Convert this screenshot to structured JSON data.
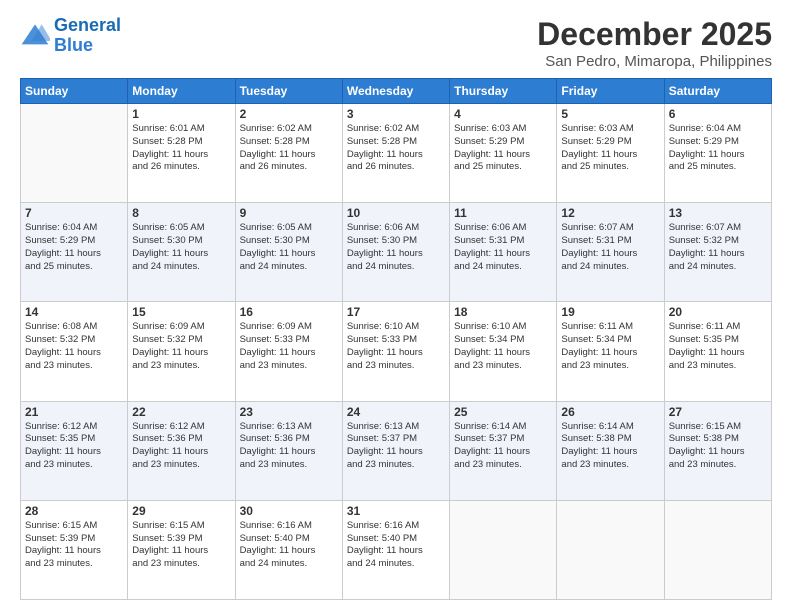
{
  "logo": {
    "line1": "General",
    "line2": "Blue"
  },
  "title": "December 2025",
  "subtitle": "San Pedro, Mimaropa, Philippines",
  "days_header": [
    "Sunday",
    "Monday",
    "Tuesday",
    "Wednesday",
    "Thursday",
    "Friday",
    "Saturday"
  ],
  "weeks": [
    [
      {
        "day": "",
        "info": ""
      },
      {
        "day": "1",
        "info": "Sunrise: 6:01 AM\nSunset: 5:28 PM\nDaylight: 11 hours\nand 26 minutes."
      },
      {
        "day": "2",
        "info": "Sunrise: 6:02 AM\nSunset: 5:28 PM\nDaylight: 11 hours\nand 26 minutes."
      },
      {
        "day": "3",
        "info": "Sunrise: 6:02 AM\nSunset: 5:28 PM\nDaylight: 11 hours\nand 26 minutes."
      },
      {
        "day": "4",
        "info": "Sunrise: 6:03 AM\nSunset: 5:29 PM\nDaylight: 11 hours\nand 25 minutes."
      },
      {
        "day": "5",
        "info": "Sunrise: 6:03 AM\nSunset: 5:29 PM\nDaylight: 11 hours\nand 25 minutes."
      },
      {
        "day": "6",
        "info": "Sunrise: 6:04 AM\nSunset: 5:29 PM\nDaylight: 11 hours\nand 25 minutes."
      }
    ],
    [
      {
        "day": "7",
        "info": "Sunrise: 6:04 AM\nSunset: 5:29 PM\nDaylight: 11 hours\nand 25 minutes."
      },
      {
        "day": "8",
        "info": "Sunrise: 6:05 AM\nSunset: 5:30 PM\nDaylight: 11 hours\nand 24 minutes."
      },
      {
        "day": "9",
        "info": "Sunrise: 6:05 AM\nSunset: 5:30 PM\nDaylight: 11 hours\nand 24 minutes."
      },
      {
        "day": "10",
        "info": "Sunrise: 6:06 AM\nSunset: 5:30 PM\nDaylight: 11 hours\nand 24 minutes."
      },
      {
        "day": "11",
        "info": "Sunrise: 6:06 AM\nSunset: 5:31 PM\nDaylight: 11 hours\nand 24 minutes."
      },
      {
        "day": "12",
        "info": "Sunrise: 6:07 AM\nSunset: 5:31 PM\nDaylight: 11 hours\nand 24 minutes."
      },
      {
        "day": "13",
        "info": "Sunrise: 6:07 AM\nSunset: 5:32 PM\nDaylight: 11 hours\nand 24 minutes."
      }
    ],
    [
      {
        "day": "14",
        "info": "Sunrise: 6:08 AM\nSunset: 5:32 PM\nDaylight: 11 hours\nand 23 minutes."
      },
      {
        "day": "15",
        "info": "Sunrise: 6:09 AM\nSunset: 5:32 PM\nDaylight: 11 hours\nand 23 minutes."
      },
      {
        "day": "16",
        "info": "Sunrise: 6:09 AM\nSunset: 5:33 PM\nDaylight: 11 hours\nand 23 minutes."
      },
      {
        "day": "17",
        "info": "Sunrise: 6:10 AM\nSunset: 5:33 PM\nDaylight: 11 hours\nand 23 minutes."
      },
      {
        "day": "18",
        "info": "Sunrise: 6:10 AM\nSunset: 5:34 PM\nDaylight: 11 hours\nand 23 minutes."
      },
      {
        "day": "19",
        "info": "Sunrise: 6:11 AM\nSunset: 5:34 PM\nDaylight: 11 hours\nand 23 minutes."
      },
      {
        "day": "20",
        "info": "Sunrise: 6:11 AM\nSunset: 5:35 PM\nDaylight: 11 hours\nand 23 minutes."
      }
    ],
    [
      {
        "day": "21",
        "info": "Sunrise: 6:12 AM\nSunset: 5:35 PM\nDaylight: 11 hours\nand 23 minutes."
      },
      {
        "day": "22",
        "info": "Sunrise: 6:12 AM\nSunset: 5:36 PM\nDaylight: 11 hours\nand 23 minutes."
      },
      {
        "day": "23",
        "info": "Sunrise: 6:13 AM\nSunset: 5:36 PM\nDaylight: 11 hours\nand 23 minutes."
      },
      {
        "day": "24",
        "info": "Sunrise: 6:13 AM\nSunset: 5:37 PM\nDaylight: 11 hours\nand 23 minutes."
      },
      {
        "day": "25",
        "info": "Sunrise: 6:14 AM\nSunset: 5:37 PM\nDaylight: 11 hours\nand 23 minutes."
      },
      {
        "day": "26",
        "info": "Sunrise: 6:14 AM\nSunset: 5:38 PM\nDaylight: 11 hours\nand 23 minutes."
      },
      {
        "day": "27",
        "info": "Sunrise: 6:15 AM\nSunset: 5:38 PM\nDaylight: 11 hours\nand 23 minutes."
      }
    ],
    [
      {
        "day": "28",
        "info": "Sunrise: 6:15 AM\nSunset: 5:39 PM\nDaylight: 11 hours\nand 23 minutes."
      },
      {
        "day": "29",
        "info": "Sunrise: 6:15 AM\nSunset: 5:39 PM\nDaylight: 11 hours\nand 23 minutes."
      },
      {
        "day": "30",
        "info": "Sunrise: 6:16 AM\nSunset: 5:40 PM\nDaylight: 11 hours\nand 24 minutes."
      },
      {
        "day": "31",
        "info": "Sunrise: 6:16 AM\nSunset: 5:40 PM\nDaylight: 11 hours\nand 24 minutes."
      },
      {
        "day": "",
        "info": ""
      },
      {
        "day": "",
        "info": ""
      },
      {
        "day": "",
        "info": ""
      }
    ]
  ]
}
